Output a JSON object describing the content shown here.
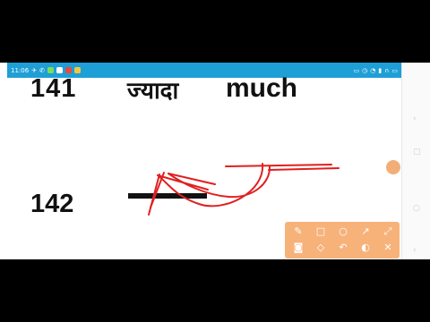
{
  "status_bar": {
    "time": "11:06"
  },
  "lesson": {
    "row1": {
      "number": "141",
      "hindi": "ज्यादा",
      "english": "much"
    },
    "row2": {
      "number": "142"
    }
  },
  "annotation_toolbar": {
    "tools": [
      "pen-icon",
      "square-icon",
      "circle-icon",
      "arrow-icon",
      "expand-icon",
      "camera-icon",
      "eraser-icon",
      "undo-icon",
      "palette-icon",
      "close-icon"
    ]
  },
  "colors": {
    "ink": "#e02020",
    "status_bar": "#1e9fd6",
    "toolbar": "#f7b27a"
  }
}
